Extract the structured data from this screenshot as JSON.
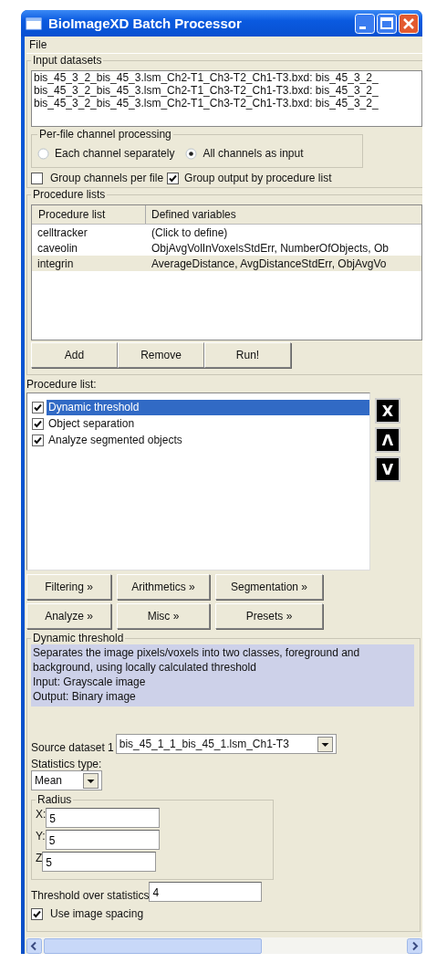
{
  "window": {
    "title": "BioImageXD Batch Processor"
  },
  "menu": [
    {
      "label": "File"
    }
  ],
  "input_datasets": {
    "legend": "Input datasets",
    "lines": [
      "bis_45_3_2_bis_45_3.lsm_Ch2-T1_Ch3-T2_Ch1-T3.bxd: bis_45_3_2_",
      "bis_45_3_2_bis_45_3.lsm_Ch2-T1_Ch3-T2_Ch1-T3.bxd: bis_45_3_2_",
      "bis_45_3_2_bis_45_3.lsm_Ch2-T1_Ch3-T2_Ch1-T3.bxd: bis_45_3_2_"
    ]
  },
  "channel_processing": {
    "legend": "Per-file channel processing",
    "options": [
      {
        "label": "Each channel separately",
        "selected": false
      },
      {
        "label": "All channels as input",
        "selected": true
      }
    ]
  },
  "group_options": [
    {
      "label": "Group channels per file",
      "checked": false
    },
    {
      "label": "Group output by procedure list",
      "checked": true
    }
  ],
  "procedure_lists": {
    "legend": "Procedure lists",
    "columns": [
      "Procedure list",
      "Defined variables"
    ],
    "rows": [
      {
        "name": "celltracker",
        "variables": "(Click to define)",
        "selected": false
      },
      {
        "name": "caveolin",
        "variables": "ObjAvgVolInVoxelsStdErr, NumberOfObjects, Ob",
        "selected": false
      },
      {
        "name": "integrin",
        "variables": "AverageDistance, AvgDistanceStdErr, ObjAvgVo",
        "selected": true
      }
    ],
    "buttons": [
      "Add",
      "Remove",
      "Run!"
    ]
  },
  "procedure_list": {
    "label": "Procedure list:",
    "items": [
      {
        "label": "Dynamic threshold",
        "checked": true,
        "selected": true
      },
      {
        "label": "Object separation",
        "checked": true,
        "selected": false
      },
      {
        "label": "Analyze segmented objects",
        "checked": true,
        "selected": false
      }
    ],
    "side_buttons": [
      "X",
      "Λ",
      "V"
    ]
  },
  "filter_buttons": [
    [
      "Filtering »",
      "Arithmetics »",
      "Segmentation »"
    ],
    [
      "Analyze »",
      "Misc »",
      "Presets »"
    ]
  ],
  "settings": {
    "legend": "Dynamic threshold",
    "description": [
      "Separates the image pixels/voxels into two classes, foreground and background, using locally calculated threshold",
      "Input: Grayscale image",
      "Output: Binary image"
    ],
    "source_dataset": {
      "label": "Source dataset 1",
      "value": "bis_45_1_1_bis_45_1.lsm_Ch1-T3"
    },
    "statistics_type": {
      "label": "Statistics type:",
      "value": "Mean"
    },
    "radius": {
      "legend": "Radius",
      "fields": [
        {
          "label": "X:",
          "value": "5"
        },
        {
          "label": "Y:",
          "value": "5"
        },
        {
          "label": "Z",
          "value": "5"
        }
      ]
    },
    "threshold": {
      "label": "Threshold over statistics",
      "value": "4"
    },
    "use_spacing": {
      "label": "Use image spacing",
      "checked": true
    }
  }
}
